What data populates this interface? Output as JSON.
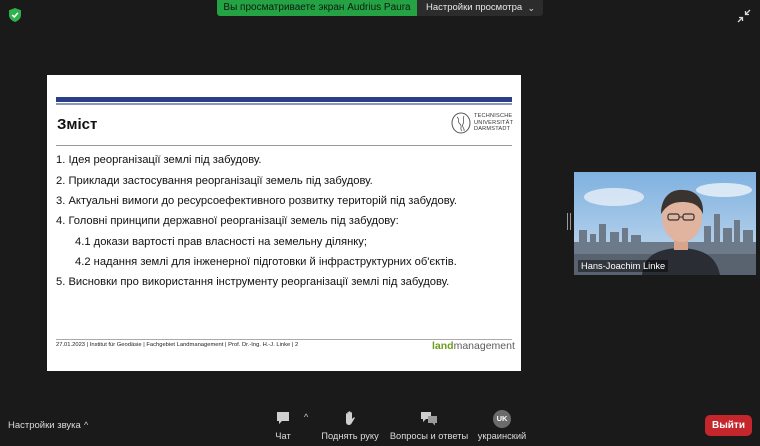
{
  "top_bar": {
    "sharing_banner": "Вы просматриваете экран Audrius Paura",
    "view_options_label": "Настройки просмотра"
  },
  "slide": {
    "heading": "Зміст",
    "university_logo_text": [
      "TECHNISCHE",
      "UNIVERSITÄT",
      "DARMSTADT"
    ],
    "items": [
      "1. Ідея реорганізації землі під забудову.",
      "2. Приклади застосування реорганізації земель під забудову.",
      "3. Актуальні вимоги до ресурсоефективного розвитку територій під забудову.",
      "4. Головні принципи державної реорганізації земель під забудову:",
      "4.1 докази вартості прав власності на земельну ділянку;",
      "4.2 надання землі для інженерної підготовки й інфраструктурних об'єктів.",
      "5.  Висновки про використання інструменту реорганізації землі під забудову."
    ],
    "footer": "27.01.2023  |  Institut für Geodäsie  |  Fachgebiet Landmanagement  |  Prof. Dr.-Ing. H.-J. Linke  |  2",
    "brand_part1": "land",
    "brand_part2": "management"
  },
  "video": {
    "participant_name": "Hans-Joachim Linke"
  },
  "toolbar": {
    "audio_settings_label": "Настройки звука",
    "chat_label": "Чат",
    "raise_hand_label": "Поднять руку",
    "qa_label": "Вопросы и ответы",
    "language_badge": "UK",
    "language_label": "украинский",
    "leave_label": "Выйти"
  },
  "colors": {
    "banner_green": "#25a244",
    "leave_red": "#c4262b",
    "slide_stripe": "#2a3f87",
    "brand_green": "#6e9d1c"
  }
}
